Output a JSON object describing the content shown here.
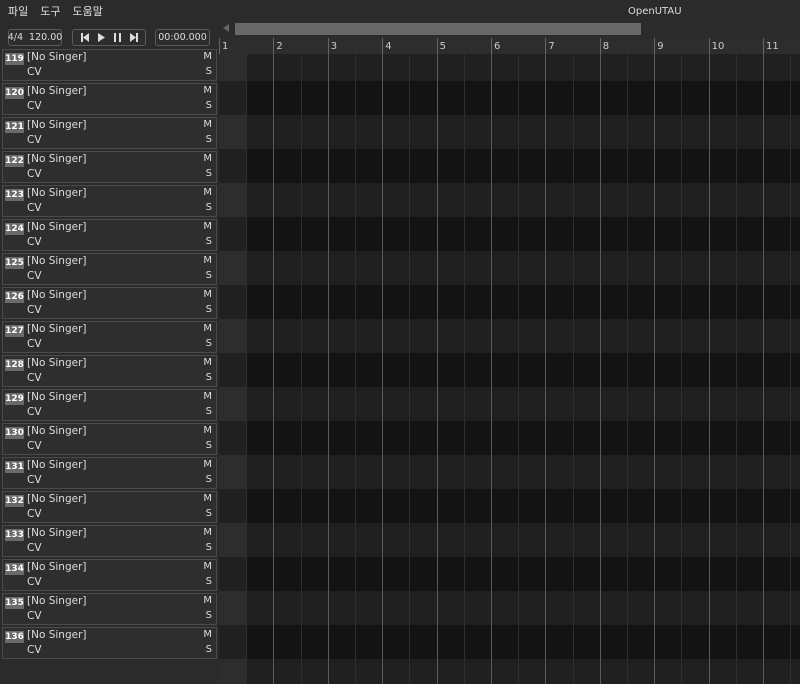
{
  "app": {
    "title": "OpenUTAU"
  },
  "menu": [
    "파일",
    "도구",
    "도움말"
  ],
  "toolbar": {
    "time_signature": "4/4",
    "bpm": "120.00",
    "clock": "00:00.000"
  },
  "ruler": {
    "bars": [
      "1",
      "2",
      "3",
      "4",
      "5",
      "6",
      "7",
      "8",
      "9",
      "10",
      "11"
    ]
  },
  "track_defaults": {
    "singer": "[No Singer]",
    "phonemizer": "CV",
    "mute": "M",
    "solo": "S"
  },
  "tracks": [
    "119",
    "120",
    "121",
    "122",
    "123",
    "124",
    "125",
    "126",
    "127",
    "128",
    "129",
    "130",
    "131",
    "132",
    "133",
    "134",
    "135",
    "136"
  ],
  "colors": {
    "background": "#2b2b2b",
    "badge": "#6a6a6a",
    "grid_dark": "#131313",
    "grid_light": "#202020"
  }
}
